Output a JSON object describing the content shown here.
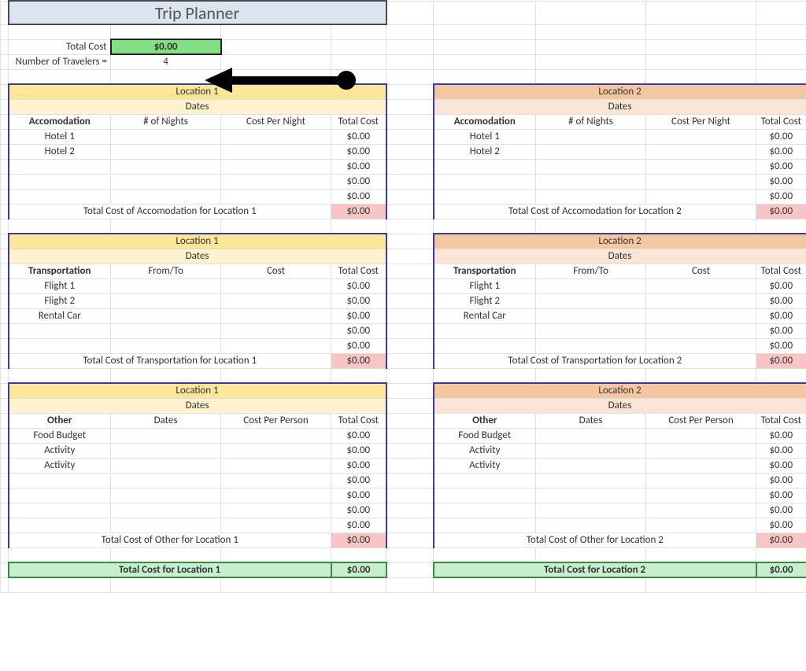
{
  "title": "Trip Planner",
  "summary": {
    "total_cost_label": "Total Cost",
    "total_cost_value": "$0.00",
    "travelers_label": "Number of Travelers  =",
    "travelers_value": "4"
  },
  "sections": {
    "accom": {
      "col1_label": "# of Nights",
      "col2_label": "Cost Per Night",
      "cat_label": "Accomodation",
      "total_col": "Total Cost",
      "rows_loc1": [
        "Hotel 1",
        "Hotel 2",
        "",
        "",
        ""
      ],
      "rows_loc2": [
        "Hotel 1",
        "Hotel 2",
        "",
        "",
        ""
      ],
      "total_label_1": "Total Cost of Accomodation for Location 1",
      "total_label_2": "Total Cost of Accomodation for Location 2",
      "row_total": "$0.00",
      "section_total": "$0.00"
    },
    "trans": {
      "col1_label": "From/To",
      "col2_label": "Cost",
      "cat_label": "Transportation",
      "total_col": "Total Cost",
      "rows_loc1": [
        "Flight 1",
        "Flight 2",
        "Rental Car",
        "",
        ""
      ],
      "rows_loc2": [
        "Flight 1",
        "Flight 2",
        "Rental Car",
        "",
        ""
      ],
      "total_label_1": "Total Cost of Transportation for Location 1",
      "total_label_2": "Total Cost of Transportation for Location 2",
      "row_total": "$0.00",
      "section_total": "$0.00"
    },
    "other": {
      "col1_label": "Dates",
      "col2_label": "Cost Per Person",
      "cat_label": "Other",
      "total_col": "Total Cost",
      "rows_loc1": [
        "Food Budget",
        "Activity",
        "Activity",
        "",
        "",
        "",
        ""
      ],
      "rows_loc2": [
        "Food Budget",
        "Activity",
        "Activity",
        "",
        "",
        "",
        ""
      ],
      "total_label_1": "Total Cost of Other for Location 1",
      "total_label_2": "Total Cost of Other for Location 2",
      "row_total": "$0.00",
      "section_total": "$0.00"
    }
  },
  "loc1_title": "Location 1",
  "loc2_title": "Location 2",
  "dates_label": "Dates",
  "grand": {
    "loc1_label": "Total Cost for Location 1",
    "loc1_value": "$0.00",
    "loc2_label": "Total Cost for Location 2",
    "loc2_value": "$0.00"
  }
}
